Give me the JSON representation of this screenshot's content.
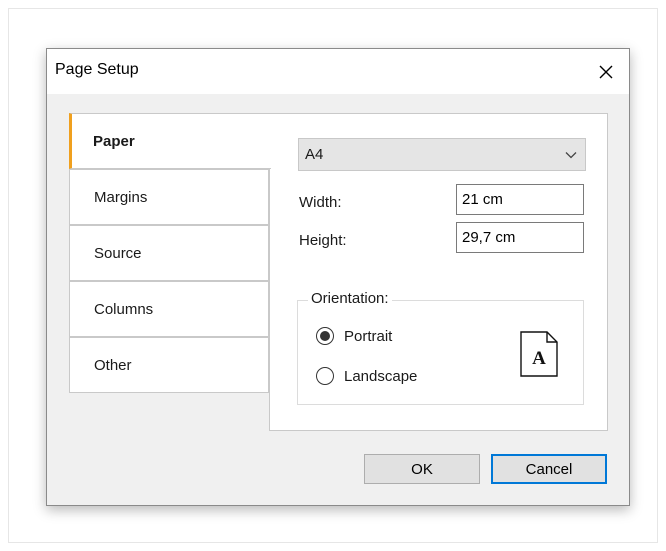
{
  "dialog": {
    "title": "Page Setup"
  },
  "tabs": [
    {
      "label": "Paper",
      "active": true
    },
    {
      "label": "Margins",
      "active": false
    },
    {
      "label": "Source",
      "active": false
    },
    {
      "label": "Columns",
      "active": false
    },
    {
      "label": "Other",
      "active": false
    }
  ],
  "paper": {
    "size_selected": "A4",
    "width_label": "Width:",
    "width_value": "21 cm",
    "height_label": "Height:",
    "height_value": "29,7 cm",
    "orientation_label": "Orientation:",
    "portrait_label": "Portrait",
    "landscape_label": "Landscape",
    "selected_orientation": "Portrait",
    "page_icon_letter": "A"
  },
  "buttons": {
    "ok": "OK",
    "cancel": "Cancel"
  },
  "icons": {
    "close": "close-icon",
    "dropdown": "chevron-down-icon",
    "page": "page-portrait-icon"
  },
  "colors": {
    "accent_tab": "#f0a01e",
    "primary_button_border": "#0078d7"
  }
}
